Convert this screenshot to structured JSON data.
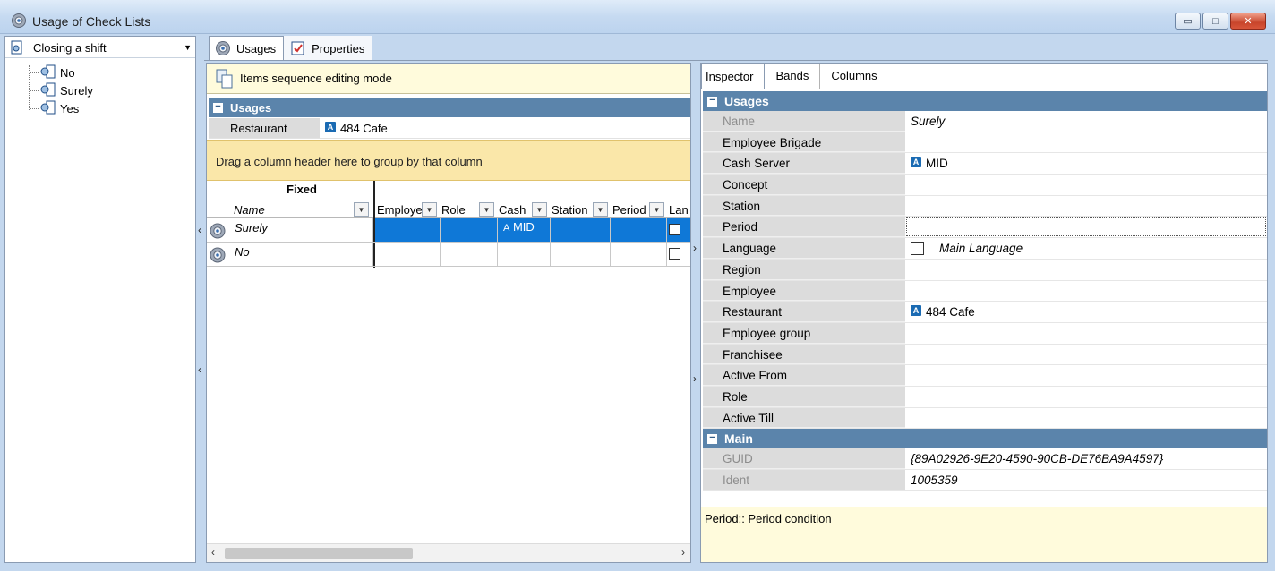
{
  "window": {
    "title": "Usage of Check Lists",
    "min_glyph": "▭",
    "max_glyph": "□",
    "close_glyph": "✕"
  },
  "left": {
    "combo_value": "Closing a shift",
    "tree_items": [
      "No",
      "Surely",
      "Yes"
    ]
  },
  "top_tabs": [
    "Usages",
    "Properties"
  ],
  "grid": {
    "sequence_bar": "Items sequence editing mode",
    "group_title": "Usages",
    "restaurant_label": "Restaurant",
    "restaurant_value": "484 Cafe",
    "group_panel_text": "Drag a column header here to group by that column",
    "fixed_band": "Fixed",
    "columns": {
      "name": "Name",
      "employee": "Employe",
      "role": "Role",
      "cash": "Cash",
      "station": "Station",
      "period": "Period",
      "language": "Lan"
    },
    "rows": [
      {
        "name": "Surely",
        "cash": "MID",
        "selected": true
      },
      {
        "name": "No",
        "cash": "",
        "selected": false
      }
    ]
  },
  "inspector": {
    "tabs": [
      "Inspector",
      "Bands",
      "Columns"
    ],
    "group_usages": "Usages",
    "group_main": "Main",
    "props": [
      {
        "key": "Name",
        "value": "Surely",
        "readonly": true,
        "italic": true
      },
      {
        "key": "Employee Brigade",
        "value": ""
      },
      {
        "key": "Cash Server",
        "value": "MID",
        "icon": true
      },
      {
        "key": "Concept",
        "value": ""
      },
      {
        "key": "Station",
        "value": ""
      },
      {
        "key": "Period",
        "value": "",
        "focus": true
      },
      {
        "key": "Language",
        "value": "Main Language",
        "checkbox": true,
        "italic": true
      },
      {
        "key": "Region",
        "value": ""
      },
      {
        "key": "Employee",
        "value": ""
      },
      {
        "key": "Restaurant",
        "value": "484 Cafe",
        "icon": true
      },
      {
        "key": "Employee group",
        "value": ""
      },
      {
        "key": "Franchisee",
        "value": ""
      },
      {
        "key": "Active From",
        "value": ""
      },
      {
        "key": "Role",
        "value": ""
      },
      {
        "key": "Active Till",
        "value": ""
      }
    ],
    "main_props": [
      {
        "key": "GUID",
        "value": "{89A02926-9E20-4590-90CB-DE76BA9A4597}",
        "readonly": true,
        "italic": true
      },
      {
        "key": "Ident",
        "value": "1005359",
        "readonly": true,
        "italic": true
      }
    ],
    "description": "Period:: Period condition"
  },
  "colors": {
    "group_header": "#5b84ab",
    "selection": "#0f78d7",
    "info_yellow": "#fffbdc",
    "drag_panel": "#fae7a9"
  }
}
